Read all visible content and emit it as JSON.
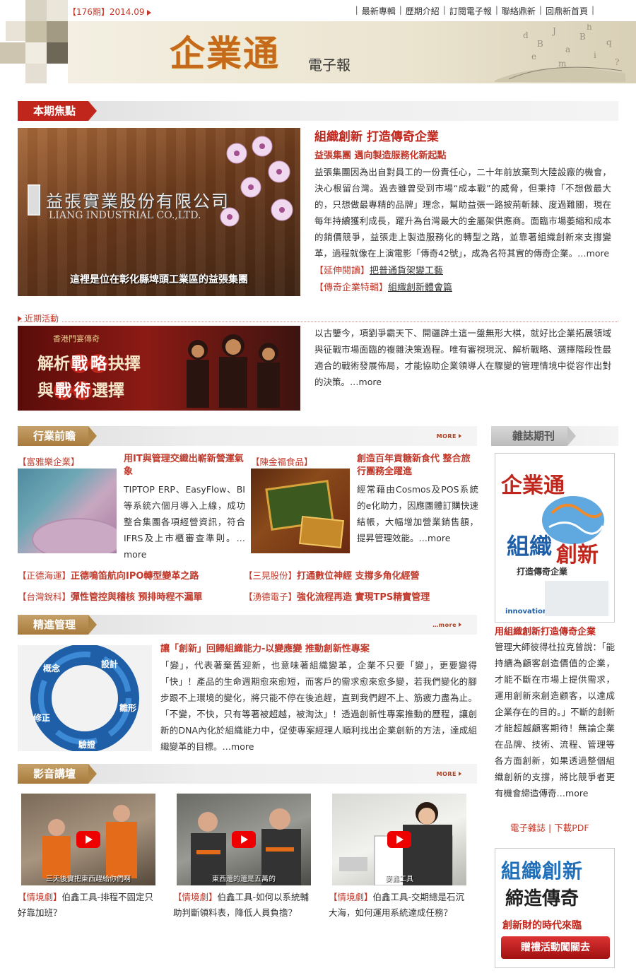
{
  "header": {
    "issue": "【176期】2014.09",
    "nav": [
      "最新專輯",
      "歷期介紹",
      "訂閱電子報",
      "聯絡鼎新",
      "回鼎新首頁"
    ],
    "logo": "企業通",
    "logo_sub": "電子報"
  },
  "focus": {
    "heading": "本期焦點",
    "photo_caption": "這裡是位在彰化縣埤頭工業區的益張集團",
    "photo_sign": "益張實業股份有限公司",
    "photo_sign_en": "LIANG INDUSTRIAL CO.,LTD.",
    "title": "組織創新 打造傳奇企業",
    "subtitle": "益張集團 邁向製造服務化新起點",
    "body": "益張集團因為出自對員工的一份責任心，二十年前放棄到大陸設廠的機會，決心根留台灣。過去雖曾受到市場“成本戰”的威脅，但秉持「不想做最大的，只想做最專精的品牌」理念，幫助益張一路披荊斬棘、度過難關，現在每年持續獲利成長，躍升為台灣最大的金屬架供應商。面臨市場萎縮和成本的銷價競爭，益張走上製造服務化的轉型之路，並靠著組織創新來支撐變革，過程就像在上演電影「傳奇42號」，成為名符其實的傳奇企業。",
    "more": "…more",
    "links": [
      {
        "tag": "【延伸閱讀】",
        "text": "把普通貨架變工藝"
      },
      {
        "tag": "【傳奇企業特輯】",
        "text": "組織創新體會篇"
      }
    ]
  },
  "event": {
    "label": "近期活動",
    "banner_top": "香港門宴傳奇",
    "banner_line1": [
      "解析",
      "戰",
      "略",
      "抉擇"
    ],
    "banner_line2": [
      "與",
      "戰",
      "術",
      "選擇"
    ],
    "body": "以古鑒今，項劉爭霸天下、開疆辟土這一盤無形大棋，就好比企業拓展領域與征戰市場面臨的複雜決策過程。唯有審視現況、解析戰略、選擇階段性最適合的戰術發展佈局，才能協助企業領導人在驟變的管理情境中從容作出對的決策。",
    "more": "…more"
  },
  "industry": {
    "heading": "行業前瞻",
    "more": "MORE",
    "cards": [
      {
        "cat": "【富雅樂企業】",
        "title": "用IT與管理交織出嶄新營運氣象",
        "body": "TIPTOP ERP、EasyFlow、BI等系統六個月導入上線，成功整合集團各項經營資訊，符合IFRS及上市櫃審查準則。",
        "more": "…more"
      },
      {
        "cat": "【陳金福食品】",
        "title": "創造百年貢糖新食代 整合旅行團務全躍進",
        "body": "經常藉由Cosmos及POS系統的e化助力，因應團體訂購快速結帳，大幅增加營業銷售額，提昇管理效能。",
        "more": "…more"
      }
    ],
    "rows": [
      [
        {
          "cat": "【正德海運】",
          "title": "正德鳴笛航向IPO轉型變革之路"
        },
        {
          "cat": "【三晃股份】",
          "title": "打通數位神經 支撐多角化經營"
        }
      ],
      [
        {
          "cat": "【台灣銳科】",
          "title": "彈性管控與稽核 預排時程不漏單"
        },
        {
          "cat": "【湧德電子】",
          "title": "強化流程再造 實現TPS精實管理"
        }
      ]
    ]
  },
  "management": {
    "heading": "精進管理",
    "more": "…more",
    "cycle": [
      "概念",
      "設計",
      "雛形",
      "驗證",
      "修正"
    ],
    "title": "讓「創新」回歸組織能力-以變應變 推動創新性專案",
    "body": "「變」，代表著棄舊迎新，也意味著組織變革，企業不只要「變」，更要變得「快」！產品的生命週期愈來愈短，而客戶的需求愈來愈多變，若我們變化的腳步跟不上環境的變化，將只能不停在後追趕，直到我們趕不上、筋疲力盡為止。「不變，不快，只有等著被超越，被淘汰」！透過創新性專案推動的歷程，讓創新的DNA內化於組織能力中，促使專案經理人順利找出企業創新的方法，達成組織變革的目標。"
  },
  "video": {
    "heading": "影音講壇",
    "more": "MORE",
    "items": [
      {
        "tag": "【情境劇】",
        "title": "伯鑫工具-排程不固定只好靠加班？",
        "sub": "三天後實把東西趕給你們啊"
      },
      {
        "tag": "【情境劇】",
        "title": "伯鑫工具-如何以系統輔助判斷領料表，降低人員負擔？",
        "sub": "東西還的還是五萬的"
      },
      {
        "tag": "【情境劇】",
        "title": "伯鑫工具-交期總是石沉大海，如何運用系統達成任務？",
        "sub": "麥鑫工具"
      }
    ]
  },
  "magazine": {
    "heading": "雜誌期刊",
    "cover_logo": "企業通",
    "cover_title1": "組織",
    "cover_title2": "創新",
    "cover_sub": "打造傳奇企業",
    "cover_badge": "innovation",
    "title": "用組織創新打造傳奇企業",
    "body": "管理大師彼得杜拉克曾說：「能持續為顧客創造價值的企業，才能不斷在市場上提供需求，運用創新來創造顧客，以達成企業存在的目的。」不斷的創新才能超越顧客期待！無論企業在品牌、技術、流程、管理等各方面創新，如果透過整個組織創新的支撐，將比競爭者更有機會締造傳奇",
    "more": "…more",
    "links": [
      "電子雜誌",
      "下載PDF"
    ],
    "promo": {
      "line1": "組織創新",
      "line2": "締造傳奇",
      "line3": "創新財的時代來臨",
      "button": "贈禮活動闖關去"
    }
  }
}
